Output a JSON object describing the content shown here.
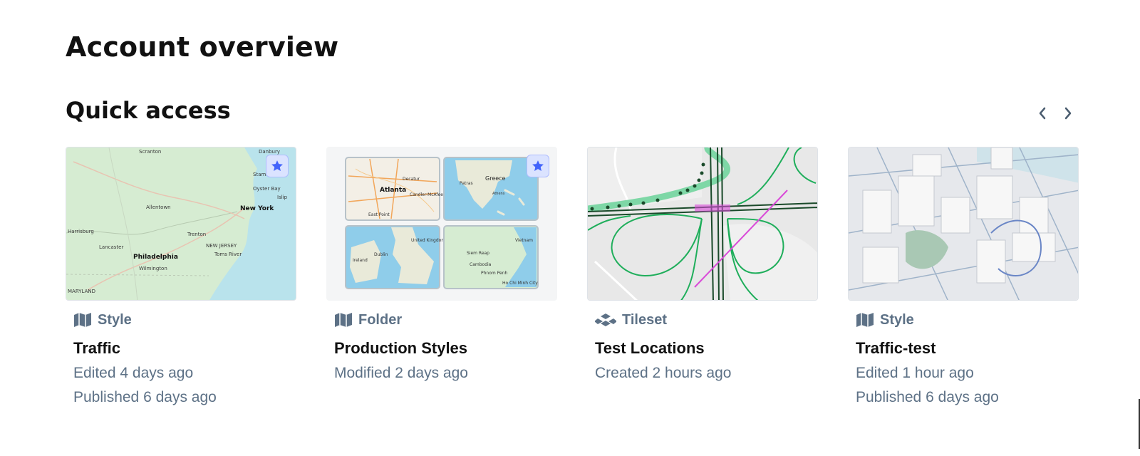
{
  "page": {
    "title": "Account overview"
  },
  "quick_access": {
    "title": "Quick access",
    "prev_icon": "chevron-left-icon",
    "next_icon": "chevron-right-icon",
    "cards": [
      {
        "type": "Style",
        "type_icon": "map-icon",
        "name": "Traffic",
        "lines": [
          "Edited 4 days ago",
          "Published 6 days ago"
        ],
        "starred": true,
        "map_labels": [
          "Scranton",
          "Danbury",
          "Stamford",
          "Oyster Bay",
          "Islip",
          "New York",
          "Allentown",
          "Harrisburg",
          "Trenton",
          "NEW JERSEY",
          "Lancaster",
          "Philadelphia",
          "Toms River",
          "Wilmington",
          "MARYLAND"
        ]
      },
      {
        "type": "Folder",
        "type_icon": "map-icon",
        "name": "Production Styles",
        "lines": [
          "Modified 2 days ago"
        ],
        "starred": true,
        "map_labels": [
          "Atlanta",
          "Decatur",
          "Candler-McAfee",
          "East Point",
          "Greece",
          "Patras",
          "Athens",
          "United Kingdom",
          "Ireland",
          "Dublin",
          "Vietnam",
          "Cambodia",
          "Siem Reap",
          "Phnom Penh",
          "Ho Chi Minh City"
        ]
      },
      {
        "type": "Tileset",
        "type_icon": "tileset-icon",
        "name": "Test Locations",
        "lines": [
          "Created 2 hours ago"
        ],
        "starred": false,
        "map_labels": []
      },
      {
        "type": "Style",
        "type_icon": "map-icon",
        "name": "Traffic-test",
        "lines": [
          "Edited 1 hour ago",
          "Published 6 days ago"
        ],
        "starred": false,
        "map_labels": []
      }
    ]
  },
  "colors": {
    "accent": "#4264fb",
    "muted": "#5d7186",
    "star_bg": "#dbe3ff"
  }
}
